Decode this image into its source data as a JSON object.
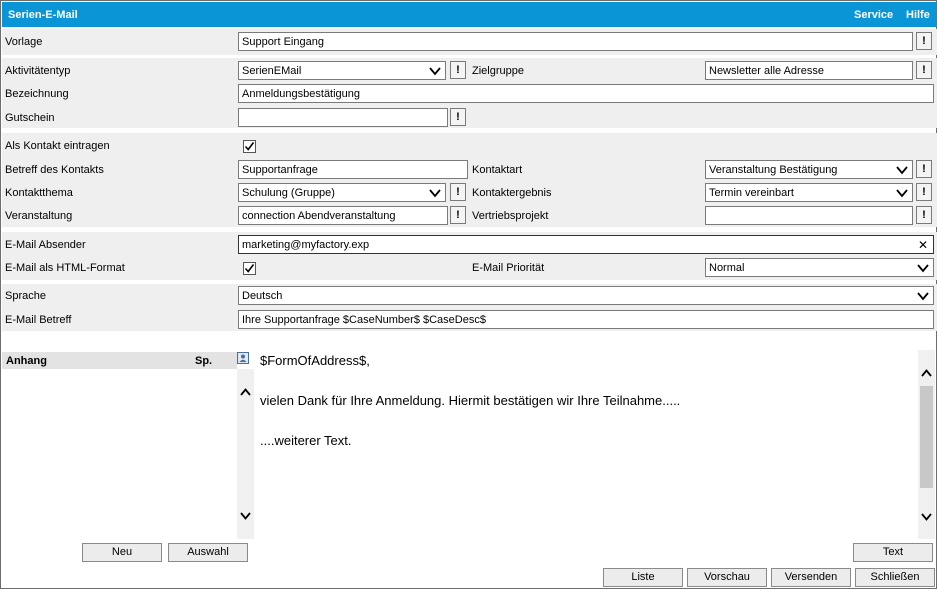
{
  "window": {
    "title": "Serien-E-Mail",
    "menu_service": "Service",
    "menu_help": "Hilfe"
  },
  "form": {
    "vorlage": {
      "label": "Vorlage",
      "value": "Support Eingang"
    },
    "aktivitaetentyp": {
      "label": "Aktivitätentyp",
      "value": "SerienEMail"
    },
    "zielgruppe": {
      "label": "Zielgruppe",
      "value": "Newsletter alle Adresse"
    },
    "bezeichnung": {
      "label": "Bezeichnung",
      "value": "Anmeldungsbestätigung"
    },
    "gutschein": {
      "label": "Gutschein",
      "value": ""
    },
    "als_kontakt": {
      "label": "Als Kontakt eintragen",
      "checked": true
    },
    "betreff_kontakt": {
      "label": "Betreff des Kontakts",
      "value": "Supportanfrage"
    },
    "kontaktart": {
      "label": "Kontaktart",
      "value": "Veranstaltung Bestätigung"
    },
    "kontaktthema": {
      "label": "Kontaktthema",
      "value": "Schulung (Gruppe)"
    },
    "kontaktergebnis": {
      "label": "Kontaktergebnis",
      "value": "Termin vereinbart"
    },
    "veranstaltung": {
      "label": "Veranstaltung",
      "value": "connection Abendveranstaltung"
    },
    "vertriebsprojekt": {
      "label": "Vertriebsprojekt",
      "value": ""
    },
    "absender": {
      "label": "E-Mail Absender",
      "value": "marketing@myfactory.exp"
    },
    "html_format": {
      "label": "E-Mail als HTML-Format",
      "checked": true
    },
    "prioritaet": {
      "label": "E-Mail Priorität",
      "value": "Normal"
    },
    "sprache": {
      "label": "Sprache",
      "value": "Deutsch"
    },
    "email_betreff": {
      "label": "E-Mail Betreff",
      "value": "Ihre Supportanfrage $CaseNumber$ $CaseDesc$"
    },
    "excl_symbol": "!",
    "clear_symbol": "✕"
  },
  "attachments": {
    "header": "Anhang",
    "col_sp": "Sp."
  },
  "body_text": {
    "line1": "$FormOfAddress$,",
    "line2": "vielen Dank für Ihre Anmeldung. Hiermit bestätigen wir Ihre Teilnahme.....",
    "line3": "....weiterer Text."
  },
  "buttons": {
    "neu": "Neu",
    "auswahl": "Auswahl",
    "text": "Text",
    "liste": "Liste",
    "vorschau": "Vorschau",
    "versenden": "Versenden",
    "schliessen": "Schließen"
  },
  "icons": {
    "chevron": "chevron-down-icon",
    "up": "chevron-up-icon",
    "attach": "contact-card-icon"
  }
}
